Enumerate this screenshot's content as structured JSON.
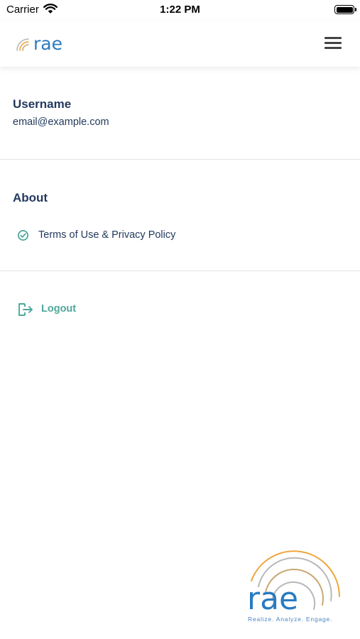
{
  "status_bar": {
    "carrier": "Carrier",
    "time": "1:22 PM",
    "icons": [
      "wifi-icon",
      "battery-icon"
    ]
  },
  "header": {
    "logo_text": "rae",
    "menu_icon": "hamburger-menu-icon"
  },
  "profile": {
    "username_label": "Username",
    "email": "email@example.com"
  },
  "about": {
    "title": "About",
    "items": [
      {
        "label": "Terms of Use & Privacy Policy",
        "icon": "check-circle-icon"
      }
    ]
  },
  "logout": {
    "label": "Logout",
    "icon": "logout-icon"
  },
  "footer": {
    "logo_text": "rae",
    "tagline": "Realize. Analyze. Engage."
  },
  "colors": {
    "navy_text": "#23395d",
    "teal_accent": "#4fa79a",
    "logo_blue": "#2a7bc0",
    "logo_orange": "#f0a43a",
    "logo_tan": "#c9a873",
    "logo_gray": "#b8b8b8",
    "divider": "#e3e3e3"
  }
}
